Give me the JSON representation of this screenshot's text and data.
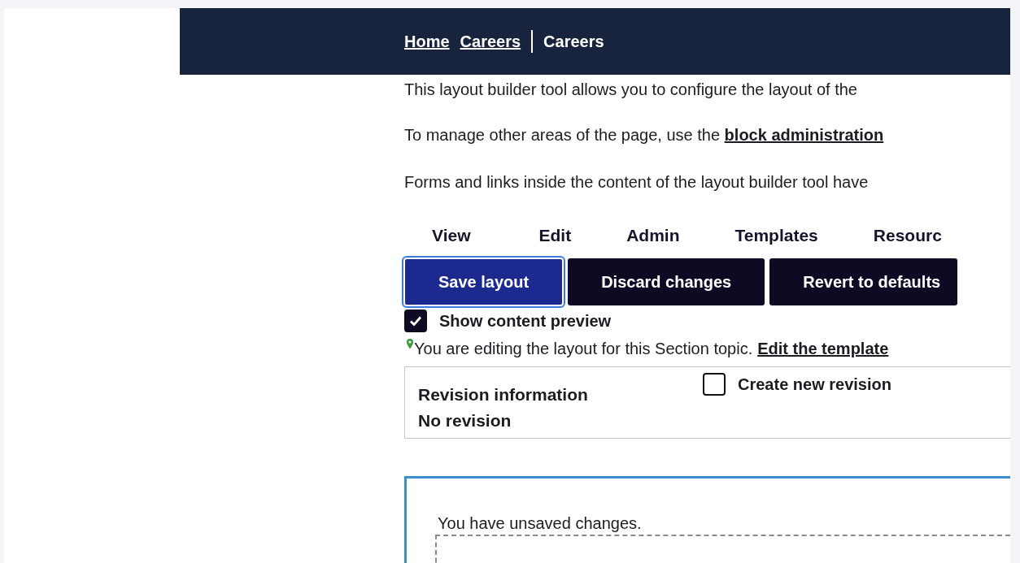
{
  "breadcrumb": {
    "links": [
      "Home",
      "Careers"
    ],
    "current": "Careers"
  },
  "intro": [
    "This layout builder tool allows you to configure the layout of the",
    "To manage other areas of the page, use the **block administration**",
    "Forms and links inside the content of the layout builder tool have"
  ],
  "tabs": [
    {
      "label": "View",
      "selected": false
    },
    {
      "label": "Edit",
      "selected": false
    },
    {
      "label": "Admin",
      "selected": false
    },
    {
      "label": "Templates",
      "selected": false
    },
    {
      "label": "Resourc",
      "selected": false
    }
  ],
  "buttons": [
    {
      "label": "Save layout",
      "focused": true
    },
    {
      "label": "Discard changes",
      "focused": false
    },
    {
      "label": "Revert to defaults",
      "focused": false
    }
  ],
  "preview": {
    "label": "Show content preview",
    "checked": true
  },
  "editing_note": {
    "text": "You are editing the layout for this Section topic.",
    "link": "Edit the template"
  },
  "revision": {
    "title": "Revision information",
    "summary": "No revision",
    "option": {
      "label": "Create new revision",
      "checked": false
    }
  },
  "message": "You have unsaved changes."
}
